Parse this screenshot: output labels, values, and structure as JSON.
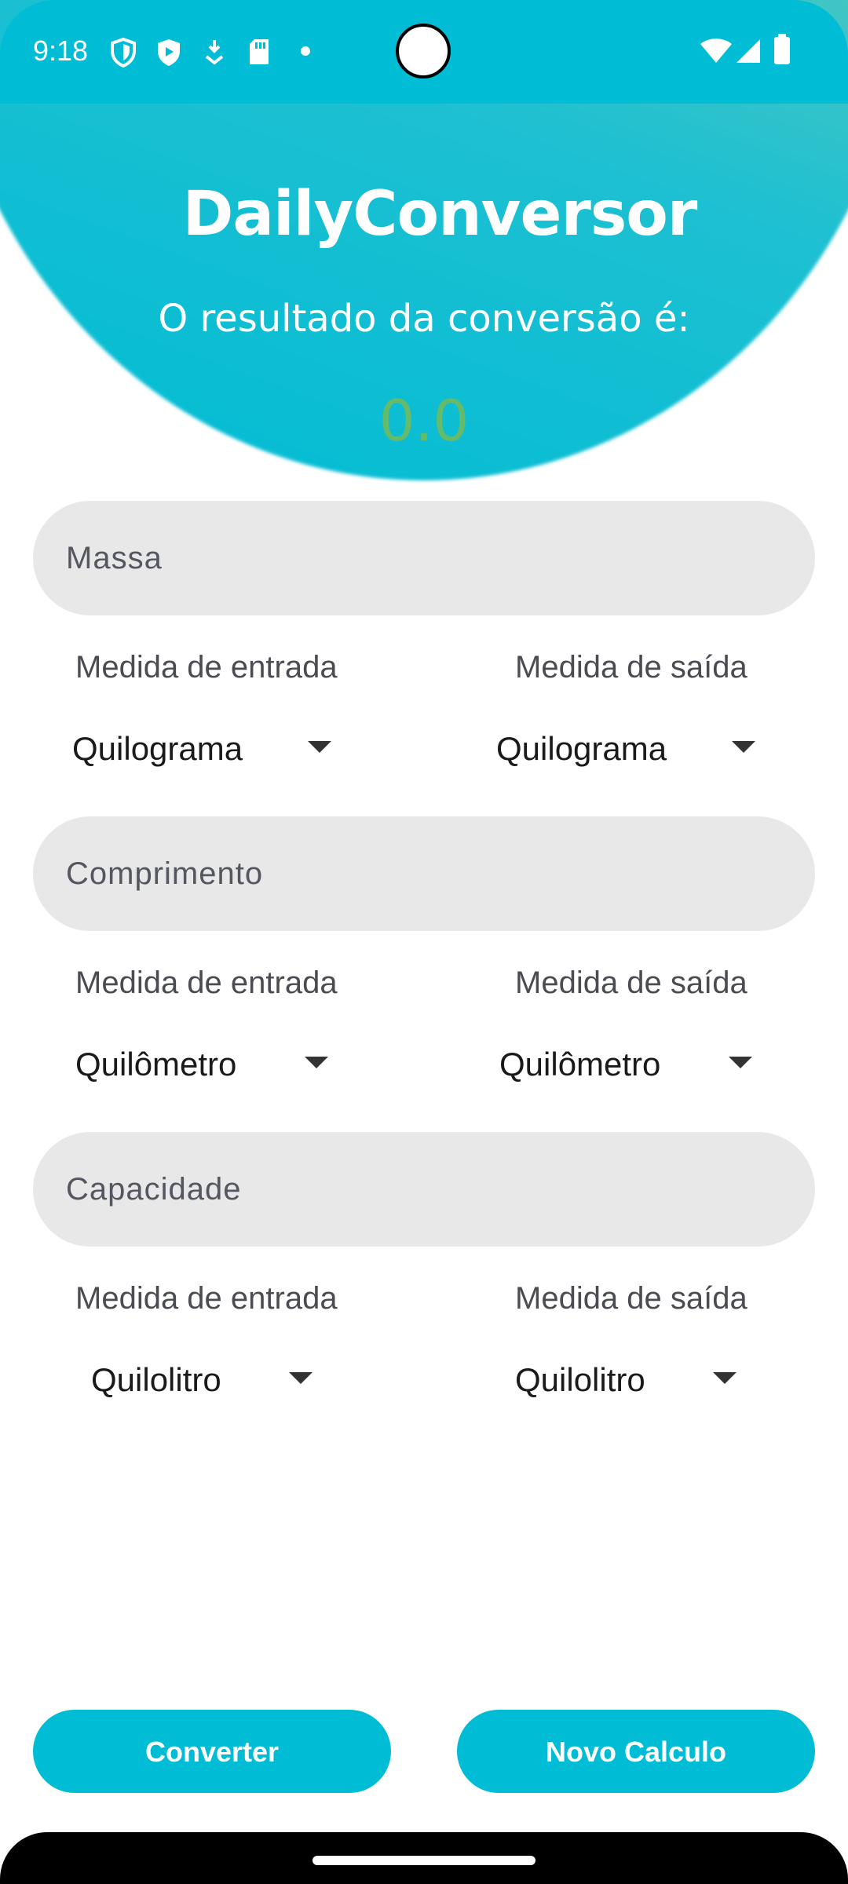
{
  "status_bar": {
    "time": "9:18",
    "icons_left": [
      "vpn-shield-icon",
      "shield-play-icon",
      "download-arrow-icon",
      "sd-card-icon",
      "notification-dot-icon"
    ],
    "icons_right": [
      "wifi-icon",
      "cellular-signal-icon",
      "battery-icon"
    ]
  },
  "header": {
    "title": "DailyConversor",
    "result_label": "O resultado da conversão é:",
    "result_value": "0.0"
  },
  "sections": [
    {
      "hint": "Massa",
      "input_label": "Medida de entrada",
      "output_label": "Medida de saída",
      "input_unit": "Quilograma",
      "output_unit": "Quilograma"
    },
    {
      "hint": "Comprimento",
      "input_label": "Medida de entrada",
      "output_label": "Medida de saída",
      "input_unit": "Quilômetro",
      "output_unit": "Quilômetro"
    },
    {
      "hint": "Capacidade",
      "input_label": "Medida de entrada",
      "output_label": "Medida de saída",
      "input_unit": "Quilolitro",
      "output_unit": "Quilolitro"
    }
  ],
  "buttons": {
    "convert": "Converter",
    "new_calc": "Novo Calculo"
  },
  "colors": {
    "accent": "#00bcd4",
    "result": "#66bb6a",
    "field_bg": "#e8e8e8",
    "gradient_end": "#88d08f"
  }
}
